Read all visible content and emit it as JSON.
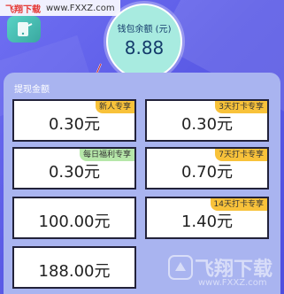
{
  "watermark": {
    "brand": "飞翔下载",
    "url": "www.FXXZ.com",
    "logo_text": "飞翔下载",
    "logo_url": "www.FXXZ.com"
  },
  "wallet": {
    "label": "钱包余额 (元)",
    "value": "8.88"
  },
  "section": {
    "title": "提现金额"
  },
  "options": [
    {
      "amount": "0.30元",
      "tag": "新人专享",
      "tag_color": "#f8c23a"
    },
    {
      "amount": "0.30元",
      "tag": "3天打卡专享",
      "tag_color": "#f8c23a"
    },
    {
      "amount": "0.30元",
      "tag": "每日福利专享",
      "tag_color": "#b6e7a9"
    },
    {
      "amount": "0.70元",
      "tag": "7天打卡专享",
      "tag_color": "#f8c23a"
    },
    {
      "amount": "100.00元",
      "tag": "",
      "tag_color": ""
    },
    {
      "amount": "1.40元",
      "tag": "14天打卡专享",
      "tag_color": "#f8c23a"
    },
    {
      "amount": "188.00元",
      "tag": "",
      "tag_color": ""
    }
  ],
  "colors": {
    "background": "#5b5be6",
    "panel": "#a9b4f0",
    "wallet_circle": "#a8ebe0",
    "tag_yellow": "#f8c23a",
    "tag_green": "#b6e7a9"
  },
  "icons": {
    "app": "phone-icon",
    "arrow": "pointer-arrow-icon"
  }
}
